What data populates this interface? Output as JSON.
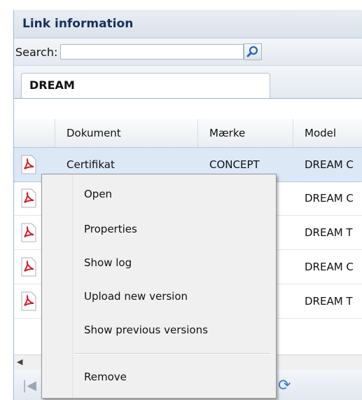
{
  "panel": {
    "title": "Link information"
  },
  "search": {
    "label": "Search:",
    "value": "",
    "button_icon": "magnifier-icon"
  },
  "tabs": [
    {
      "label": "DREAM",
      "active": true
    }
  ],
  "grid": {
    "columns": [
      "",
      "Dokument",
      "Mærke",
      "Model"
    ],
    "rows": [
      {
        "icon": "pdf-icon",
        "dokument": "Certifikat",
        "maerke": "CONCEPT",
        "model": "DREAM C",
        "selected": true
      },
      {
        "icon": "pdf-icon",
        "dokument": "",
        "maerke": "",
        "model": "DREAM C",
        "selected": false
      },
      {
        "icon": "pdf-icon",
        "dokument": "",
        "maerke": "",
        "model": "DREAM T",
        "selected": false
      },
      {
        "icon": "pdf-icon",
        "dokument": "",
        "maerke": "",
        "model": "DREAM C",
        "selected": false
      },
      {
        "icon": "pdf-icon",
        "dokument": "",
        "maerke": "",
        "model": "DREAM T",
        "selected": false
      }
    ]
  },
  "context_menu": {
    "items": [
      "Open",
      "Properties",
      "Show log",
      "Upload new version",
      "Show previous versions"
    ],
    "danger_item": "Remove"
  },
  "colors": {
    "accent": "#15325c",
    "selected_row": "#dde8f7",
    "pdf_red": "#d11f2a"
  }
}
